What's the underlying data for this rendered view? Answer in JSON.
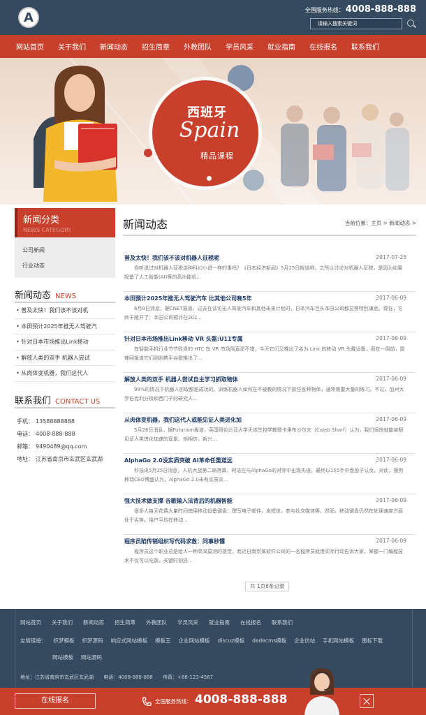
{
  "header": {
    "logo_letter": "A",
    "hotline_label": "全国服务热线：",
    "hotline_number": "4008-888-888",
    "search_placeholder": "请输入搜索关键词"
  },
  "nav": [
    "网站首页",
    "关于我们",
    "新闻动态",
    "招生简章",
    "外教团队",
    "学员风采",
    "就业指南",
    "在线报名",
    "联系我们"
  ],
  "banner": {
    "script_text": "Spain",
    "title_cn": "西班牙",
    "subtitle": "精品课程"
  },
  "sidebar": {
    "category_title": "新闻分类",
    "category_subtitle": "NEWS CATEGORY",
    "categories": [
      "公司新闻",
      "行业动态"
    ],
    "news_title": "新闻动态",
    "news_title_en": "NEWS",
    "news_items": [
      "普及太快！我们该不该对机",
      "本田预计2025年推无人驾驶汽",
      "针对日本市场推出Link移动",
      "解放人类的双手 机器人尝试",
      "从肉体变机器，我们这代人"
    ],
    "contact_title": "联系我们",
    "contact_title_en": "CONTACT US",
    "contact": [
      {
        "key": "手机：",
        "value": "13588888888"
      },
      {
        "key": "电话：",
        "value": "4008-888-888"
      },
      {
        "key": "邮箱：",
        "value": "9490489@qq.com"
      },
      {
        "key": "地址：",
        "value": "江苏省南京市玄武区玄武湖"
      }
    ]
  },
  "main": {
    "title": "新闻动态",
    "breadcrumb": "当前位置：主页 > 新闻动态 >",
    "articles": [
      {
        "title": "普及太快！我们该不该对机器人征税呢",
        "date": "2017-07-25",
        "desc": "你听说过对机器人征税这种科幻小说一样的事吗？《日本经济新闻》5月25日报道称，之所以讨论对机器人征税，是因为如果配备了人工智能(AI)等的高功能机..."
      },
      {
        "title": "本田预计2025年推无人驾驶汽车 比其他公司晚5年",
        "date": "2017-06-09",
        "desc": "6月9日消息，据CNET报道，过去在谈论无人驾驶汽车和其他未来计划时，日本汽车巨头本田公司都显得特别谦逊。现在，它终于敞开了：本田公司预计在202..."
      },
      {
        "title": "针对日本市场推出Link移动 VR 头盔:U11专属",
        "date": "2017-06-09",
        "desc": "在智能手机行业节节败退的 HTC 在 VR 市场简直还不错，今天它们又推出了名为 Link 的移动 VR 头戴设备，而在一周前，雷锋网报道它们刚刚携手谷歌推出了..."
      },
      {
        "title": "解放人类的双手 机器人尝试自主学习抓取物体",
        "date": "2017-06-09",
        "desc": "98%的情况下机器人抓取都是成功的。训练机器人如何在不被教的情况下抓住各种物体，通常需要大量的练习。不过，加州大学伯克利分校和西门子的研究人..."
      },
      {
        "title": "从肉体变机器，我们这代人或能见证人类进化加",
        "date": "2017-06-09",
        "desc": "5月26日消息，据Futurism报道，英国哥伦比亚大学天体生物学教授卡里布沙尔夫（Caleb Sharf）认为，我们很快就能亲眼见证人类进化加速的现象。他相信，新兴..."
      },
      {
        "title": "AlphaGo 2.0没实质突破 AI革命任重道远",
        "date": "2017-06-09",
        "desc": "科技讯5月25日消息，人机大战第二局落幕，柯洁在与AlphaGo的对弈中出现失误，最终以155手中盘投子认负。对此，搜狗移动CEO博盛认为，AlphaGo 2.0未有实质突..."
      },
      {
        "title": "强大技术做支撑 谷歌输入法背后的机器智能",
        "date": "2017-06-09",
        "desc": "很多人每天花费大量时间使用移动设备键盘：撰写电子邮件，发短信，参与社交媒体等。然而，移动键盘仍然在处理速度方面处于劣势。用户平均在移动..."
      },
      {
        "title": "程序员陷传销组织写代码求救：同事秒懂",
        "date": "2017-06-09",
        "desc": "程序员这个职业总是给人一种高深莫测的感觉，而近日南京某软件公司的一名程序员就用实际行动告诉大家，掌握一门编程技术不仅可以吃饭，关键时刻还..."
      }
    ],
    "pagination": "共 1页8条记录"
  },
  "footer": {
    "nav": [
      "网站首页",
      "关于我们",
      "新闻动态",
      "招生简章",
      "外教团队",
      "学员风采",
      "就业指南",
      "在线报名",
      "联系我们"
    ],
    "links_label": "友情链接：",
    "links": [
      "织梦模板",
      "织梦源码",
      "响应式网站模板",
      "模板王",
      "企业网站模板",
      "discuz模板",
      "dedecms模板",
      "企业仿站",
      "手机网站模板",
      "图标下载",
      "网站模板",
      "网站源码"
    ],
    "address": "地址：江苏省南京市玄武区玄武湖",
    "phone": "电话：4008-888-888",
    "fax": "传真：+86-123-4567"
  },
  "bottom_bar": {
    "signup_label": "在线报名",
    "hotline_label": "全国服务热线：",
    "hotline_number": "4008-888-888"
  },
  "colors": {
    "header_bg": "#354a5e",
    "accent_red": "#c8402c",
    "link_blue": "#1f3a66"
  }
}
